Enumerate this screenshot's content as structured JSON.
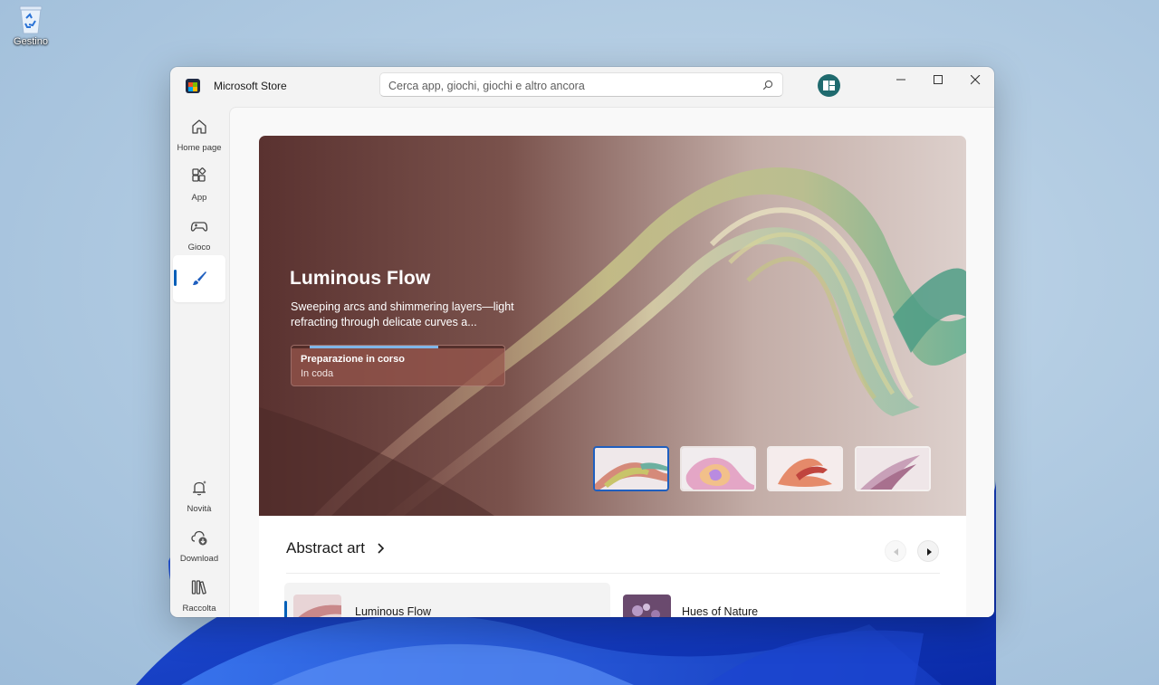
{
  "desktop": {
    "recycle_bin_label": "Gestino"
  },
  "window": {
    "app_title": "Microsoft Store",
    "search_placeholder": "Cerca app, giochi, giochi e altro ancora"
  },
  "sidebar": {
    "top_items": [
      {
        "label": "Home page",
        "icon": "home-icon"
      },
      {
        "label": "App",
        "icon": "apps-icon"
      },
      {
        "label": "Gioco",
        "icon": "gamepad-icon"
      },
      {
        "label": "",
        "icon": "paintbrush-icon",
        "active": true
      }
    ],
    "bottom_items": [
      {
        "label": "Novità",
        "icon": "bell-sparkle-icon"
      },
      {
        "label": "Download",
        "icon": "cloud-download-icon"
      },
      {
        "label": "Raccolta",
        "icon": "library-icon"
      }
    ]
  },
  "hero": {
    "title": "Luminous Flow",
    "description": "Sweeping arcs and shimmering layers—light refracting through delicate curves a...",
    "status_title": "Preparazione in corso",
    "status_subtitle": "In coda",
    "progress_fraction": 0.6,
    "thumbnail_count": 4,
    "selected_thumbnail": 0
  },
  "section": {
    "title": "Abstract art",
    "cards": [
      {
        "name": "Luminous Flow",
        "selected": true
      },
      {
        "name": "Hues of Nature",
        "selected": false
      }
    ]
  },
  "colors": {
    "accent": "#005fb8",
    "progress": "#7fb6e8"
  }
}
